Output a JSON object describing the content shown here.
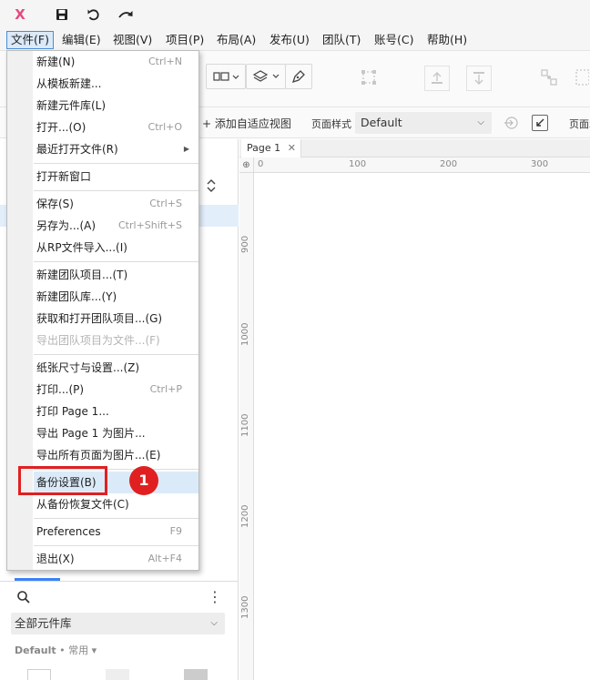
{
  "toolbar": {
    "logo": "X",
    "icons": [
      "save-icon",
      "undo-icon",
      "redo-icon"
    ]
  },
  "menubar": {
    "items": [
      {
        "label": "文件(F)"
      },
      {
        "label": "编辑(E)"
      },
      {
        "label": "视图(V)"
      },
      {
        "label": "项目(P)"
      },
      {
        "label": "布局(A)"
      },
      {
        "label": "发布(U)"
      },
      {
        "label": "团队(T)"
      },
      {
        "label": "账号(C)"
      },
      {
        "label": "帮助(H)"
      }
    ]
  },
  "stylebar": {
    "add_view": "+ 添加自适应视图",
    "page_style_label": "页面样式",
    "page_style_value": "Default",
    "page_more_label": "页面x"
  },
  "canvas": {
    "tab_label": "Page 1",
    "ruler_top": [
      "0",
      "100",
      "200",
      "300"
    ],
    "ruler_left": [
      "900",
      "1000",
      "1100",
      "1200",
      "1300"
    ]
  },
  "left_panel": {
    "library_select": "全部元件库",
    "library_tag_bold": "Default",
    "library_tag_rest": " • 常用 ▾"
  },
  "file_menu": {
    "items": [
      {
        "label": "新建(N)",
        "shortcut": "Ctrl+N"
      },
      {
        "label": "从模板新建...",
        "shortcut": ""
      },
      {
        "label": "新建元件库(L)",
        "shortcut": ""
      },
      {
        "label": "打开...(O)",
        "shortcut": "Ctrl+O"
      },
      {
        "label": "最近打开文件(R)",
        "shortcut": ""
      },
      {
        "label": "打开新窗口",
        "shortcut": ""
      },
      {
        "label": "保存(S)",
        "shortcut": "Ctrl+S"
      },
      {
        "label": "另存为...(A)",
        "shortcut": "Ctrl+Shift+S"
      },
      {
        "label": "从RP文件导入...(I)",
        "shortcut": ""
      },
      {
        "label": "新建团队项目...(T)",
        "shortcut": ""
      },
      {
        "label": "新建团队库...(Y)",
        "shortcut": ""
      },
      {
        "label": "获取和打开团队项目...(G)",
        "shortcut": ""
      },
      {
        "label": "导出团队项目为文件...(F)",
        "shortcut": ""
      },
      {
        "label": "纸张尺寸与设置...(Z)",
        "shortcut": ""
      },
      {
        "label": "打印...(P)",
        "shortcut": "Ctrl+P"
      },
      {
        "label": "打印 Page 1...",
        "shortcut": ""
      },
      {
        "label": "导出 Page 1 为图片...",
        "shortcut": ""
      },
      {
        "label": "导出所有页面为图片...(E)",
        "shortcut": ""
      },
      {
        "label": "备份设置(B)",
        "shortcut": ""
      },
      {
        "label": "从备份恢复文件(C)",
        "shortcut": ""
      },
      {
        "label": "Preferences",
        "shortcut": "F9"
      },
      {
        "label": "退出(X)",
        "shortcut": "Alt+F4"
      }
    ]
  },
  "annotation": {
    "badge": "1",
    "color": "#e02020"
  }
}
